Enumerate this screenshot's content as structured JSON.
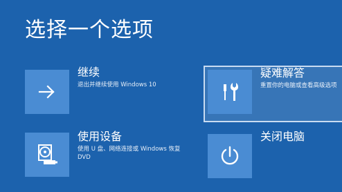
{
  "page": {
    "title": "选择一个选项",
    "background_color": "#1c62ad",
    "tile_color": "#4a8cd3"
  },
  "options": [
    {
      "title": "继续",
      "description": "退出并继续使用 Windows 10",
      "icon": "arrow-right-icon",
      "selected": false
    },
    {
      "title": "疑难解答",
      "description": "重置你的电脑或查看高级选项",
      "icon": "tools-icon",
      "selected": true
    },
    {
      "title": "使用设备",
      "description": "使用 U 盘、网络连接或 Windows 恢复 DVD",
      "icon": "disc-drive-icon",
      "selected": false
    },
    {
      "title": "关闭电脑",
      "description": "",
      "icon": "power-icon",
      "selected": false
    }
  ]
}
